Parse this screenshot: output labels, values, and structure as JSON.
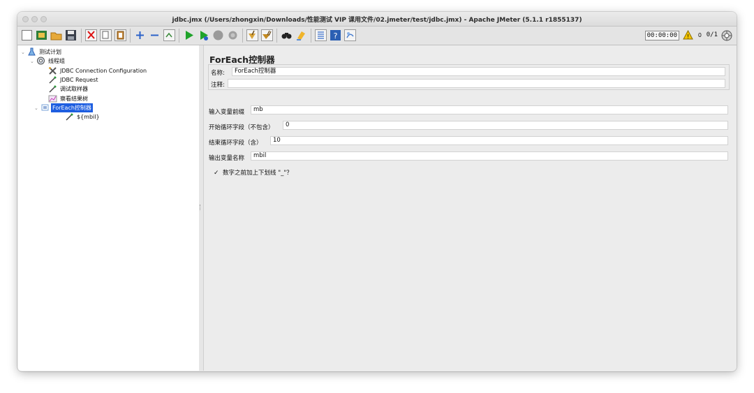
{
  "window": {
    "title": "jdbc.jmx (/Users/zhongxin/Downloads/性能测试 VIP 课用文件/02.jmeter/test/jdbc.jmx) - Apache JMeter (5.1.1 r1855137)"
  },
  "toolbar": {
    "buttons": [
      {
        "name": "new",
        "icon": "new-icon"
      },
      {
        "name": "templates",
        "icon": "templates-icon"
      },
      {
        "name": "open",
        "icon": "open-folder-icon"
      },
      {
        "name": "save",
        "icon": "save-icon"
      },
      {
        "name": "cut",
        "icon": "cut-icon"
      },
      {
        "name": "copy",
        "icon": "copy-icon"
      },
      {
        "name": "paste",
        "icon": "paste-icon"
      },
      {
        "name": "expand",
        "icon": "plus-icon"
      },
      {
        "name": "collapse",
        "icon": "minus-icon"
      },
      {
        "name": "toggle",
        "icon": "toggle-icon"
      },
      {
        "name": "start",
        "icon": "play-icon"
      },
      {
        "name": "start-no-pause",
        "icon": "play-nopause-icon"
      },
      {
        "name": "stop",
        "icon": "stop-icon"
      },
      {
        "name": "shutdown",
        "icon": "shutdown-icon"
      },
      {
        "name": "clear",
        "icon": "broom-icon"
      },
      {
        "name": "clear-all",
        "icon": "broom-all-icon"
      },
      {
        "name": "search",
        "icon": "binoculars-icon"
      },
      {
        "name": "reset-search",
        "icon": "reset-search-icon"
      },
      {
        "name": "function-helper",
        "icon": "list-icon"
      },
      {
        "name": "help",
        "icon": "help-icon"
      },
      {
        "name": "log-viewer",
        "icon": "log-icon"
      }
    ],
    "timer": "00:00:00",
    "warnings": "0",
    "threads": "0/1",
    "colors": {
      "play": "#1fa32a",
      "stop": "#9a9a9a",
      "warning": "#f2c300"
    }
  },
  "tree": [
    {
      "label": "测试计划",
      "icon": "test-plan-icon",
      "toggle": "⌄"
    },
    {
      "label": "线程组",
      "icon": "thread-group-icon",
      "toggle": "⌄"
    },
    {
      "label": "JDBC Connection Configuration",
      "icon": "config-element-icon",
      "toggle": ""
    },
    {
      "label": "JDBC Request",
      "icon": "sampler-icon",
      "toggle": ""
    },
    {
      "label": "调试取样器",
      "icon": "sampler-icon",
      "toggle": ""
    },
    {
      "label": "察看结果树",
      "icon": "listener-icon",
      "toggle": ""
    },
    {
      "label": "ForEach控制器",
      "icon": "foreach-controller-icon",
      "toggle": "⌄",
      "selected": true
    },
    {
      "label": "${mbil}",
      "icon": "sampler-icon",
      "toggle": ""
    }
  ],
  "panel": {
    "title": "ForEach控制器",
    "name_label": "名称:",
    "name_value": "ForEach控制器",
    "comment_label": "注释:",
    "comment_value": "",
    "input_prefix_label": "输入变量前缀",
    "input_prefix_value": "mb",
    "start_index_label": "开始循环字段（不包含）",
    "start_index_value": "0",
    "end_index_label": "结束循环字段（含）",
    "end_index_value": "10",
    "output_var_label": "输出变量名称",
    "output_var_value": "mbil",
    "underscore_label": "数字之前加上下划线 \"_\"？",
    "underscore_checked": "✓"
  }
}
